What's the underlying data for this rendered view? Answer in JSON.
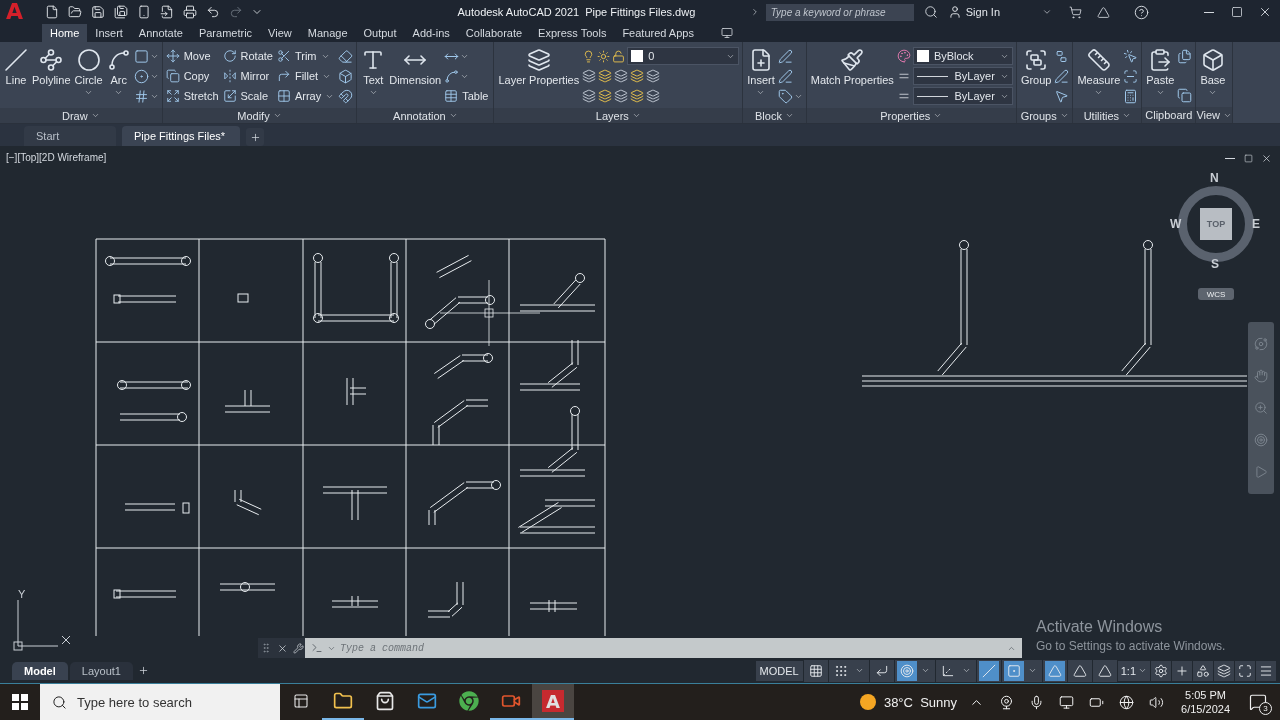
{
  "title_bar": {
    "logo": "A",
    "app_title": "Autodesk AutoCAD 2021",
    "file_title": "Pipe Fittings Files.dwg",
    "search": {
      "placeholder": "Type a keyword or phrase"
    },
    "sign_in": "Sign In"
  },
  "ribbon_tabs": [
    {
      "label": "Home",
      "selected": true
    },
    {
      "label": "Insert",
      "selected": false
    },
    {
      "label": "Annotate",
      "selected": false
    },
    {
      "label": "Parametric",
      "selected": false
    },
    {
      "label": "View",
      "selected": false
    },
    {
      "label": "Manage",
      "selected": false
    },
    {
      "label": "Output",
      "selected": false
    },
    {
      "label": "Add-ins",
      "selected": false
    },
    {
      "label": "Collaborate",
      "selected": false
    },
    {
      "label": "Express Tools",
      "selected": false
    },
    {
      "label": "Featured Apps",
      "selected": false
    }
  ],
  "ribbon_panels": [
    {
      "title": "Draw",
      "menu": true,
      "columns": [
        [
          {
            "kind": "large",
            "label": "Line",
            "menu": false
          }
        ],
        [
          {
            "kind": "large",
            "label": "Polyline",
            "menu": false
          }
        ],
        [
          {
            "kind": "large",
            "label": "Circle",
            "menu": true
          }
        ],
        [
          {
            "kind": "large",
            "label": "Arc",
            "menu": true
          }
        ],
        [
          {
            "kind": "icon",
            "menu": true
          },
          {
            "kind": "icon",
            "menu": true
          },
          {
            "kind": "icon",
            "menu": true
          }
        ]
      ]
    },
    {
      "title": "Modify",
      "menu": true,
      "columns": [
        [
          {
            "kind": "small",
            "label": "Move",
            "menu": false
          },
          {
            "kind": "small",
            "label": "Copy",
            "menu": false
          },
          {
            "kind": "small",
            "label": "Stretch",
            "menu": false
          }
        ],
        [
          {
            "kind": "small",
            "label": "Rotate",
            "menu": false
          },
          {
            "kind": "small",
            "label": "Mirror",
            "menu": false
          },
          {
            "kind": "small",
            "label": "Scale",
            "menu": false
          }
        ],
        [
          {
            "kind": "small",
            "label": "Trim",
            "menu": true
          },
          {
            "kind": "small",
            "label": "Fillet",
            "menu": true
          },
          {
            "kind": "small",
            "label": "Array",
            "menu": true
          }
        ],
        [
          {
            "kind": "icon",
            "menu": false
          },
          {
            "kind": "icon",
            "menu": false
          },
          {
            "kind": "icon",
            "menu": false
          }
        ]
      ]
    },
    {
      "title": "Annotation",
      "menu": true,
      "columns": [
        [
          {
            "kind": "large",
            "label": "Text",
            "menu": true
          }
        ],
        [
          {
            "kind": "large",
            "label": "Dimension",
            "menu": false
          }
        ],
        [
          {
            "kind": "icon",
            "menu": true
          },
          {
            "kind": "icon",
            "menu": true
          },
          {
            "kind": "small",
            "label": "Table",
            "menu": false
          }
        ]
      ]
    },
    {
      "title": "Layers",
      "menu": true,
      "columns": [
        [
          {
            "kind": "large",
            "label": "Layer Properties",
            "menu": false
          }
        ],
        [
          {
            "kind": "layer_dropdown",
            "value": "0"
          },
          {
            "kind": "icon_row"
          },
          {
            "kind": "icon_row"
          }
        ]
      ]
    },
    {
      "title": "Block",
      "menu": true,
      "columns": [
        [
          {
            "kind": "large",
            "label": "Insert",
            "menu": true
          }
        ],
        [
          {
            "kind": "icon",
            "menu": false
          },
          {
            "kind": "icon",
            "menu": false
          },
          {
            "kind": "icon",
            "menu": true
          }
        ]
      ]
    },
    {
      "title": "Properties",
      "menu": true,
      "columns": [
        [
          {
            "kind": "large",
            "label": "Match Properties",
            "menu": false
          }
        ],
        [
          {
            "kind": "color_dropdown",
            "value": "ByBlock"
          },
          {
            "kind": "line_dropdown",
            "value": "ByLayer"
          },
          {
            "kind": "line_dropdown",
            "value": "ByLayer"
          }
        ]
      ]
    },
    {
      "title": "Groups",
      "menu": true,
      "columns": [
        [
          {
            "kind": "large",
            "label": "Group",
            "menu": false
          }
        ],
        [
          {
            "kind": "icon",
            "menu": false
          },
          {
            "kind": "icon",
            "menu": false
          },
          {
            "kind": "icon",
            "menu": false
          }
        ]
      ]
    },
    {
      "title": "Utilities",
      "menu": true,
      "columns": [
        [
          {
            "kind": "large",
            "label": "Measure",
            "menu": true
          }
        ],
        [
          {
            "kind": "icon",
            "menu": false
          },
          {
            "kind": "icon",
            "menu": false
          },
          {
            "kind": "icon",
            "menu": false
          }
        ]
      ]
    },
    {
      "title": "Clipboard",
      "menu": false,
      "columns": [
        [
          {
            "kind": "large",
            "label": "Paste",
            "menu": true
          }
        ],
        [
          {
            "kind": "icon",
            "menu": false
          },
          {
            "kind": "icon",
            "menu": false
          }
        ]
      ]
    },
    {
      "title": "View",
      "menu": true,
      "columns": [
        [
          {
            "kind": "large",
            "label": "Base",
            "menu": true
          }
        ]
      ]
    }
  ],
  "document_tabs": [
    {
      "label": "Start",
      "selected": false
    },
    {
      "label": "Pipe Fittings Files*",
      "selected": true
    }
  ],
  "viewport": {
    "label": "[−][Top][2D Wireframe]",
    "viewcube": {
      "north": "N",
      "south": "S",
      "east": "E",
      "west": "W",
      "face": "TOP",
      "coordinate_system": "WCS"
    },
    "ucs": {
      "y_axis": "Y"
    },
    "command_line": {
      "placeholder": "Type a command"
    }
  },
  "layout_tabs": [
    {
      "label": "Model",
      "selected": true
    },
    {
      "label": "Layout1",
      "selected": false
    }
  ],
  "status_bar": {
    "space": "MODEL",
    "toggles": [
      {
        "on": false,
        "menu": false
      },
      {
        "on": false,
        "menu": true
      },
      {
        "on": false,
        "menu": false
      },
      {
        "on": true,
        "menu": true
      },
      {
        "on": false,
        "menu": true
      },
      {
        "on": true,
        "menu": false
      },
      {
        "on": true,
        "menu": true
      },
      {
        "on": true,
        "menu": false
      },
      {
        "on": false,
        "menu": false
      },
      {
        "on": false,
        "menu": false
      }
    ],
    "scale": "1:1"
  },
  "activation_notice": {
    "title": "Activate Windows",
    "message": "Go to Settings to activate Windows."
  },
  "taskbar": {
    "search": {
      "placeholder": "Type here to search"
    },
    "apps": [
      {
        "kind": "folder",
        "running": true,
        "selected": false
      },
      {
        "kind": "store",
        "running": false,
        "selected": false
      },
      {
        "kind": "mail",
        "running": false,
        "selected": false
      },
      {
        "kind": "browser",
        "running": false,
        "selected": false
      },
      {
        "kind": "camera",
        "running": true,
        "selected": false
      },
      {
        "kind": "autocad",
        "logo": "A",
        "running": true,
        "selected": true
      }
    ],
    "weather": {
      "temperature": "38°C",
      "condition": "Sunny"
    },
    "time": "5:05 PM",
    "date": "6/15/2024",
    "notifications": "3"
  }
}
